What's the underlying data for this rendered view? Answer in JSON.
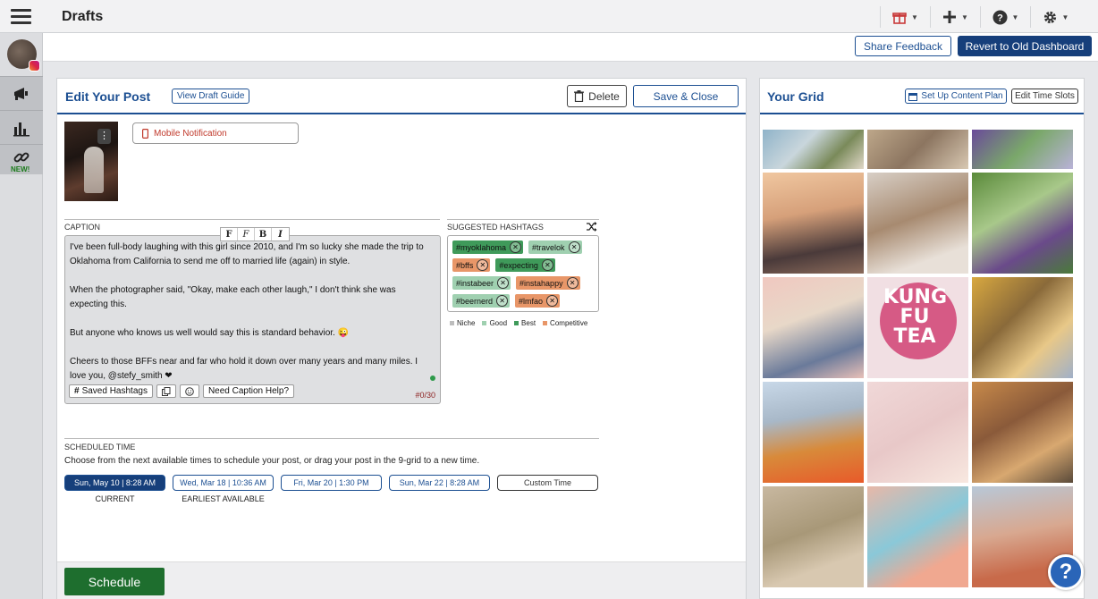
{
  "header": {
    "title": "Drafts"
  },
  "icons": {
    "menu": "hamburger-icon",
    "gift": "gift-icon",
    "add": "plus-icon",
    "help": "question-icon",
    "settings": "gear-icon"
  },
  "subbar": {
    "feedback_label": "Share Feedback",
    "revert_label": "Revert to Old Dashboard"
  },
  "sidebar": {
    "new_badge": "NEW!"
  },
  "edit": {
    "title": "Edit Your Post",
    "guide_label": "View Draft Guide",
    "delete_label": "Delete",
    "save_close_label": "Save & Close",
    "mobile_notification_label": "Mobile Notification",
    "caption_heading": "CAPTION",
    "format_buttons": [
      "F",
      "F",
      "B",
      "I"
    ],
    "caption_paragraphs": [
      "I've been full-body laughing with this girl since 2010, and I'm so lucky she made the trip to Oklahoma from California to send me off to married life (again) in style.",
      "When the photographer said, \"Okay, make each other laugh,\" I don't think she was expecting this.",
      "But anyone who knows us well would say this is standard behavior. 😜",
      "Cheers to those BFFs near and far who hold it down over many years and many miles. I love you, @stefy_smith ❤"
    ],
    "saved_hashtags_label": "Saved Hashtags",
    "caption_help_label": "Need Caption Help?",
    "char_count": "#0/30",
    "hashtags_heading": "SUGGESTED HASHTAGS",
    "hashtag_rows": [
      [
        {
          "tag": "#myoklahoma",
          "kind": "best"
        },
        {
          "tag": "#travelok",
          "kind": "good"
        }
      ],
      [
        {
          "tag": "#bffs",
          "kind": "comp"
        },
        {
          "tag": "#expecting",
          "kind": "best"
        }
      ],
      [
        {
          "tag": "#instabeer",
          "kind": "good"
        },
        {
          "tag": "#instahappy",
          "kind": "comp"
        }
      ],
      [
        {
          "tag": "#beernerd",
          "kind": "good"
        },
        {
          "tag": "#lmfao",
          "kind": "comp"
        }
      ]
    ],
    "legend": [
      {
        "label": "Niche",
        "color": "#bdbdbd"
      },
      {
        "label": "Good",
        "color": "#9fd0b0"
      },
      {
        "label": "Best",
        "color": "#3f9a5a"
      },
      {
        "label": "Competitive",
        "color": "#e89668"
      }
    ],
    "scheduled_heading": "SCHEDULED TIME",
    "scheduled_desc": "Choose from the next available times to schedule your post, or drag your post in the 9-grid to a new time.",
    "slots": [
      {
        "label": "Sun, May 10 | 8:28 AM",
        "sub": "CURRENT"
      },
      {
        "label": "Wed, Mar 18 | 10:36 AM",
        "sub": "EARLIEST AVAILABLE"
      },
      {
        "label": "Fri, Mar 20 | 1:30 PM",
        "sub": ""
      },
      {
        "label": "Sun, Mar 22 | 8:28 AM",
        "sub": ""
      },
      {
        "label": "Custom Time",
        "sub": ""
      }
    ],
    "schedule_label": "Schedule"
  },
  "grid": {
    "title": "Your Grid",
    "plan_label": "Set Up Content Plan",
    "slots_label": "Edit Time Slots",
    "kungfu_text": "KUNG FU TEA"
  },
  "colors": {
    "brand_blue": "#1c4f92",
    "dark_blue": "#163f7b",
    "schedule_green": "#1e6e2e"
  }
}
